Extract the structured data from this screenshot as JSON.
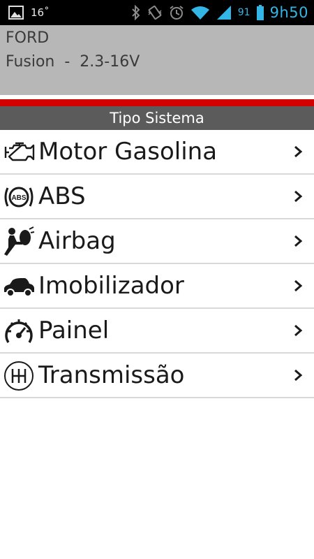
{
  "status_bar": {
    "left_icons": [
      "gallery-icon"
    ],
    "temperature": "16˚",
    "right_icons": [
      "bluetooth-icon",
      "vibrate-icon",
      "alarm-icon",
      "wifi-icon",
      "signal-icon",
      "battery-icon"
    ],
    "battery_percent": "91",
    "time": "9h50",
    "accent_color": "#33b5e5"
  },
  "vehicle": {
    "make": "FORD",
    "model": "Fusion  -  2.3-16V"
  },
  "header_colors": {
    "panel": "#b7b7b7",
    "stripe": "#d20000",
    "section": "#5b5b5b"
  },
  "section": {
    "title": "Tipo Sistema"
  },
  "systems": [
    {
      "label": "Motor Gasolina",
      "icon": "engine-icon"
    },
    {
      "label": "ABS",
      "icon": "abs-icon"
    },
    {
      "label": "Airbag",
      "icon": "airbag-icon"
    },
    {
      "label": "Imobilizador",
      "icon": "car-icon"
    },
    {
      "label": "Painel",
      "icon": "gauge-icon"
    },
    {
      "label": "Transmissão",
      "icon": "gearshift-icon"
    }
  ]
}
